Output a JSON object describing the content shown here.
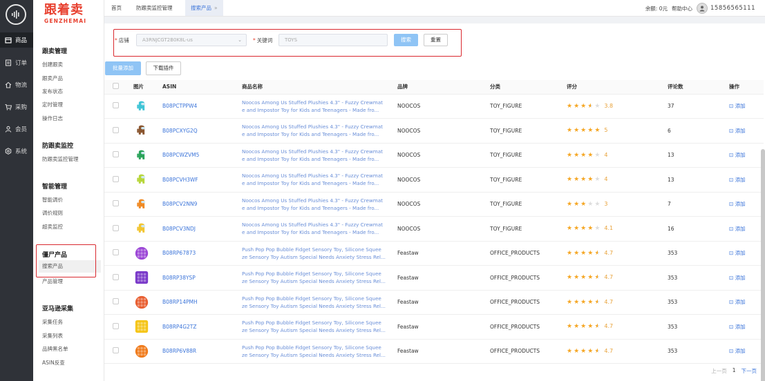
{
  "rail": {
    "items": [
      {
        "label": "商品",
        "icon": "box-icon"
      },
      {
        "label": "订单",
        "icon": "order-icon"
      },
      {
        "label": "物流",
        "icon": "home-icon"
      },
      {
        "label": "采购",
        "icon": "cart-icon"
      },
      {
        "label": "会员",
        "icon": "user-icon"
      },
      {
        "label": "系统",
        "icon": "gear-icon"
      }
    ]
  },
  "brand": {
    "cn": "跟着卖",
    "en": "GENZHEMAI"
  },
  "sidebar": {
    "groups": [
      {
        "title": "跟卖管理",
        "items": [
          "创建跟卖",
          "跟卖产品",
          "发布状态",
          "定时管理",
          "操作日志"
        ]
      },
      {
        "title": "防跟卖监控",
        "items": [
          "防跟卖监控管理"
        ]
      },
      {
        "title": "智能管理",
        "items": [
          "智能调价",
          "调价规则",
          "超卖监控"
        ]
      },
      {
        "title": "僵尸产品",
        "items": [
          "搜索产品",
          "产品管理"
        ]
      },
      {
        "title": "亚马逊采集",
        "items": [
          "采集任务",
          "采集列表",
          "品牌黑名单",
          "ASIN反查"
        ]
      }
    ]
  },
  "tabs": [
    {
      "label": "首页"
    },
    {
      "label": "防跟卖监控管理"
    },
    {
      "label": "搜索产品",
      "close": "»"
    }
  ],
  "topright": {
    "balance": "余额: 0元",
    "help": "帮助中心",
    "phone": "15856565111"
  },
  "search": {
    "shop_label": "店铺",
    "shop_value": "A3RNJCGT2B0K8L-us",
    "keyword_label": "关键词",
    "keyword_placeholder": "TOYS",
    "search_btn": "搜索",
    "reset_btn": "重置"
  },
  "toolbar": {
    "batch_add": "批量添加",
    "download_plugin": "下载插件"
  },
  "table": {
    "headers": [
      "图片",
      "ASIN",
      "商品名称",
      "品牌",
      "分类",
      "评分",
      "评论数",
      "操作"
    ],
    "add_label": "添加",
    "rows": [
      {
        "asin": "B08PCTPPW4",
        "name1": "Noocos Among Us Stuffed Plushies 4.3\" - Fuzzy Crewmat",
        "name2": "e and Impostor Toy for Kids and Teenagers - Made fro...",
        "brand": "NOOCOS",
        "category": "TOY_FIGURE",
        "rating": 3.8,
        "score": "3.8",
        "reviews": "37",
        "color": "#3fc4d6"
      },
      {
        "asin": "B08PCXYG2Q",
        "name1": "Noocos Among Us Stuffed Plushies 4.3\" - Fuzzy Crewmat",
        "name2": "e and Impostor Toy for Kids and Teenagers - Made fro...",
        "brand": "NOOCOS",
        "category": "TOY_FIGURE",
        "rating": 5,
        "score": "5",
        "reviews": "6",
        "color": "#8a5630"
      },
      {
        "asin": "B08PCWZVM5",
        "name1": "Noocos Among Us Stuffed Plushies 4.3\" - Fuzzy Crewmat",
        "name2": "e and Impostor Toy for Kids and Teenagers - Made fro...",
        "brand": "NOOCOS",
        "category": "TOY_FIGURE",
        "rating": 4,
        "score": "4",
        "reviews": "13",
        "color": "#2aa35a"
      },
      {
        "asin": "B08PCVH3WF",
        "name1": "Noocos Among Us Stuffed Plushies 4.3\" - Fuzzy Crewmat",
        "name2": "e and Impostor Toy for Kids and Teenagers - Made fro...",
        "brand": "NOOCOS",
        "category": "TOY_FIGURE",
        "rating": 4,
        "score": "4",
        "reviews": "13",
        "color": "#b7d63a"
      },
      {
        "asin": "B08PCV2NN9",
        "name1": "Noocos Among Us Stuffed Plushies 4.3\" - Fuzzy Crewmat",
        "name2": "e and Impostor Toy for Kids and Teenagers - Made fro...",
        "brand": "NOOCOS",
        "category": "TOY_FIGURE",
        "rating": 3,
        "score": "3",
        "reviews": "7",
        "color": "#f08a24"
      },
      {
        "asin": "B08PCV3NDJ",
        "name1": "Noocos Among Us Stuffed Plushies 4.3\" - Fuzzy Crewmat",
        "name2": "e and Impostor Toy for Kids and Teenagers - Made fro...",
        "brand": "NOOCOS",
        "category": "TOY_FIGURE",
        "rating": 4.1,
        "score": "4.1",
        "reviews": "16",
        "color": "#f2c531"
      },
      {
        "asin": "B08RP67873",
        "name1": "Push Pop Pop Bubble Fidget Sensory Toy, Silicone Squee",
        "name2": "ze Sensory Toy Autism Special Needs Anxiety Stress Rel...",
        "brand": "Feastaw",
        "category": "OFFICE_PRODUCTS",
        "rating": 4.7,
        "score": "4.7",
        "reviews": "353",
        "color": "#9b45d6"
      },
      {
        "asin": "B08RP38YSP",
        "name1": "Push Pop Pop Bubble Fidget Sensory Toy, Silicone Squee",
        "name2": "ze Sensory Toy Autism Special Needs Anxiety Stress Rel...",
        "brand": "Feastaw",
        "category": "OFFICE_PRODUCTS",
        "rating": 4.7,
        "score": "4.7",
        "reviews": "353",
        "color": "#7a3ac9"
      },
      {
        "asin": "B08RP14PMH",
        "name1": "Push Pop Pop Bubble Fidget Sensory Toy, Silicone Squee",
        "name2": "ze Sensory Toy Autism Special Needs Anxiety Stress Rel...",
        "brand": "Feastaw",
        "category": "OFFICE_PRODUCTS",
        "rating": 4.7,
        "score": "4.7",
        "reviews": "353",
        "color": "#e85d2f"
      },
      {
        "asin": "B08RP4G2TZ",
        "name1": "Push Pop Pop Bubble Fidget Sensory Toy, Silicone Squee",
        "name2": "ze Sensory Toy Autism Special Needs Anxiety Stress Rel...",
        "brand": "Feastaw",
        "category": "OFFICE_PRODUCTS",
        "rating": 4.7,
        "score": "4.7",
        "reviews": "353",
        "color": "#f5c518"
      },
      {
        "asin": "B08RP6V88R",
        "name1": "Push Pop Pop Bubble Fidget Sensory Toy, Silicone Squee",
        "name2": "ze Sensory Toy Autism Special Needs Anxiety Stress Rel...",
        "brand": "Feastaw",
        "category": "OFFICE_PRODUCTS",
        "rating": 4.7,
        "score": "4.7",
        "reviews": "353",
        "color": "#f07a1a"
      }
    ]
  },
  "pager": {
    "prev": "上一页",
    "page": "1",
    "next": "下一页"
  }
}
